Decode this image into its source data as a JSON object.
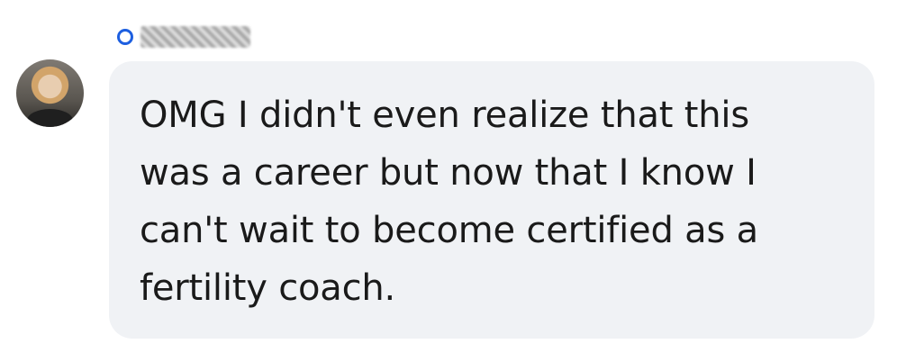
{
  "comment": {
    "author_status_icon": "status-ring-icon",
    "author_name_redacted": true,
    "text": "OMG I didn't even realize that this was a career but now that I know I can't wait to become certified as a fertility coach."
  },
  "colors": {
    "status_ring": "#1d5fe0",
    "bubble_background": "#f0f2f5",
    "text": "#1a1a1a"
  }
}
